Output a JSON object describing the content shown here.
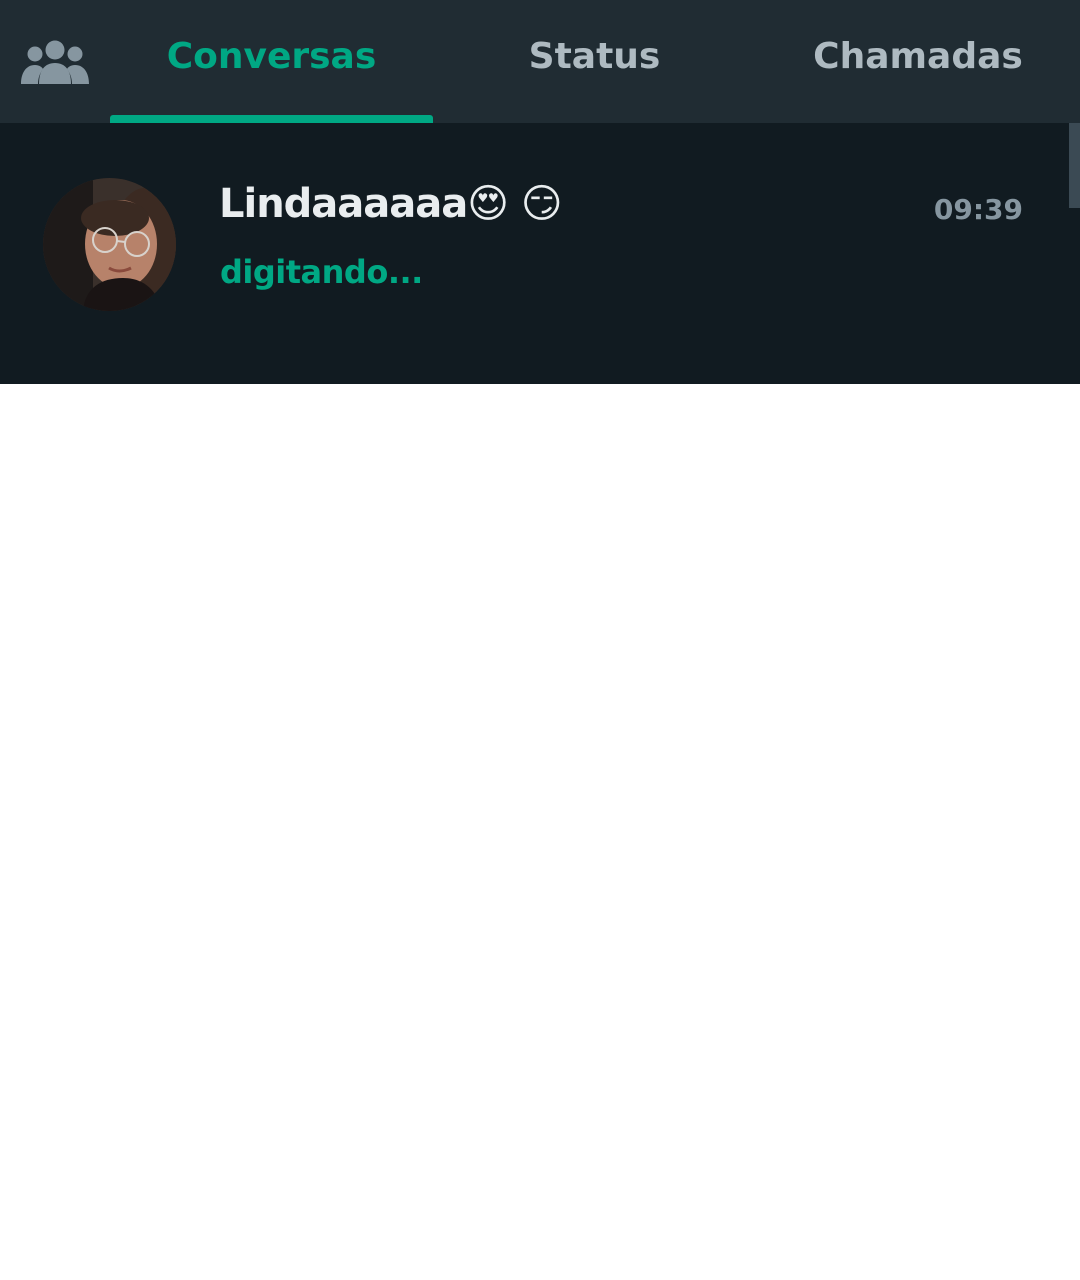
{
  "tabs": {
    "community_icon": "community-icon",
    "items": [
      {
        "label": "Conversas",
        "active": true
      },
      {
        "label": "Status",
        "active": false
      },
      {
        "label": "Chamadas",
        "active": false
      }
    ]
  },
  "chats": [
    {
      "name": "Lindaaaaaa😍 😏",
      "status": "digitando...",
      "time": "09:39"
    }
  ],
  "colors": {
    "header_bg": "#202c33",
    "list_bg": "#111b21",
    "accent": "#00a884",
    "tab_inactive": "#aebac1",
    "time_text": "#8696a0",
    "name_text": "#e9edef"
  }
}
